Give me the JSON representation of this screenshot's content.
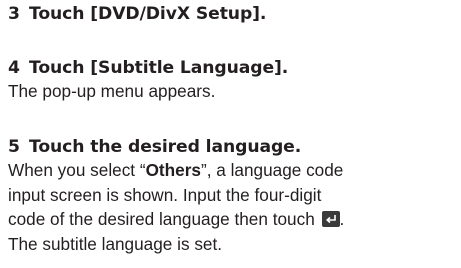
{
  "steps": [
    {
      "number": "3",
      "heading": "Touch [DVD/DivX Setup]."
    },
    {
      "number": "4",
      "heading": "Touch [Subtitle Language].",
      "body": "The pop-up menu appears."
    },
    {
      "number": "5",
      "heading": "Touch the desired language.",
      "body_line1_prefix": "When you select “",
      "body_line1_bold": "Others",
      "body_line1_suffix": "”, a language code",
      "body_line2": "input screen is shown. Input the four-digit",
      "body_line3": "code of the desired language then touch",
      "body_line3_end": ".",
      "body_line4": "The subtitle language is set."
    }
  ],
  "icons": {
    "enter_key": "enter-return-icon"
  }
}
